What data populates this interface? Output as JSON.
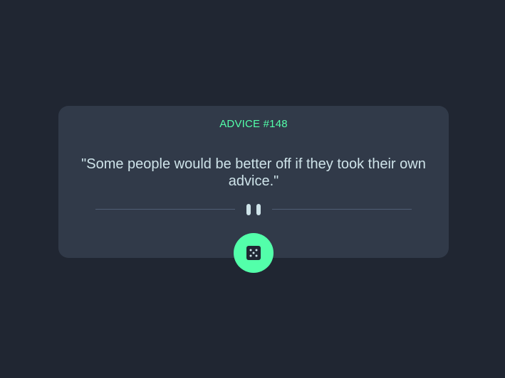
{
  "card": {
    "advice_label": "ADVICE #148",
    "quote": "\"Some people would be better off if they took their own advice.\""
  },
  "divider": {
    "icon": "pause-icon"
  },
  "actions": {
    "dice_button_icon": "dice-icon"
  },
  "colors": {
    "background": "#202632",
    "card": "#313a49",
    "accent": "#53ffaa",
    "text": "#cee3e9",
    "divider": "#4f5d74"
  }
}
